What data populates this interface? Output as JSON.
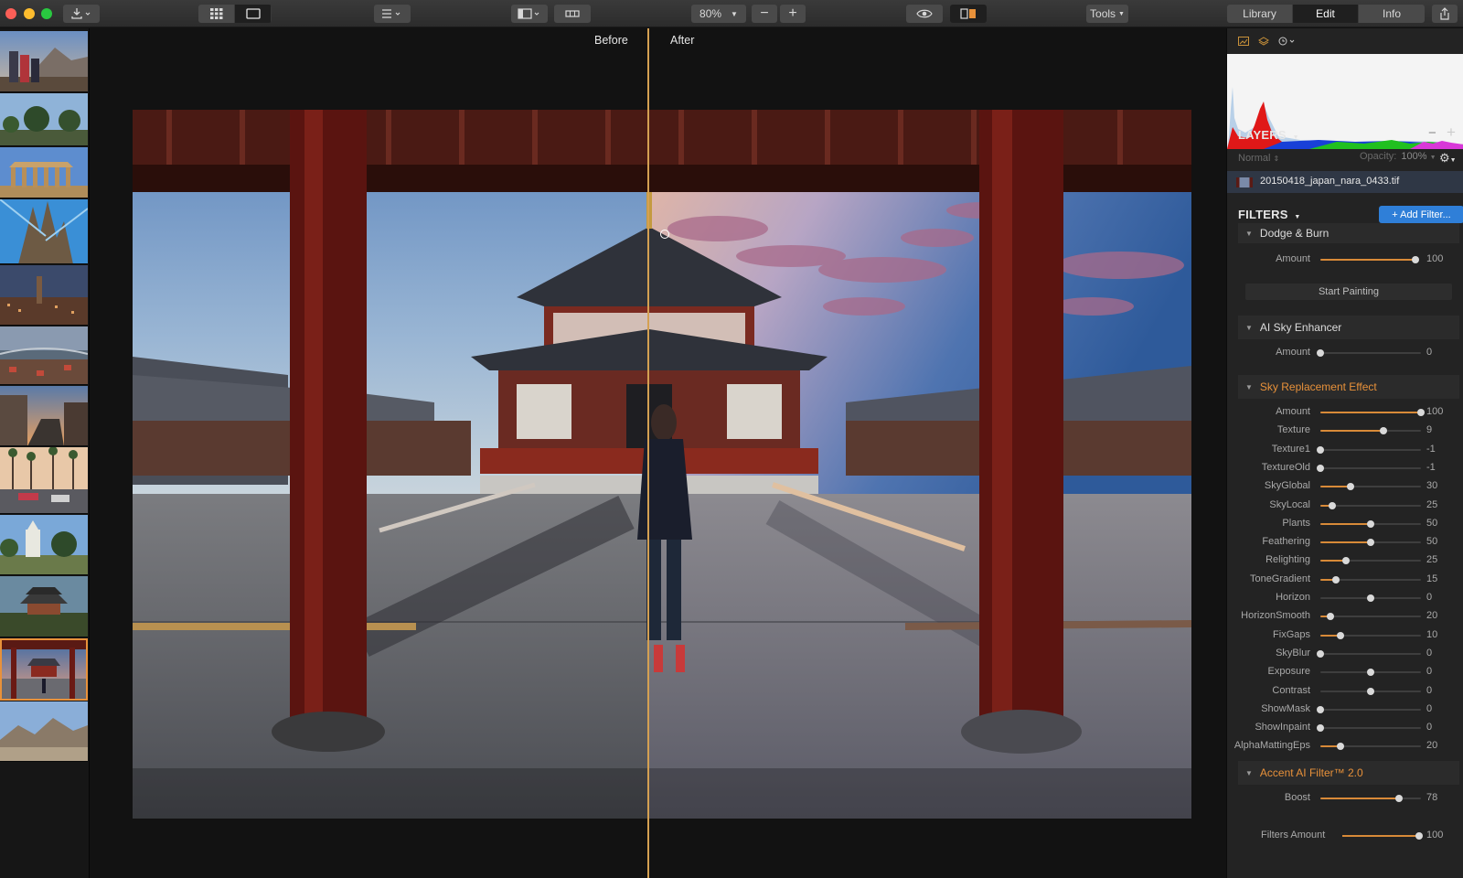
{
  "toolbar": {
    "zoom": "80%",
    "tools_label": "Tools",
    "mode_tabs": [
      "Library",
      "Edit",
      "Info"
    ],
    "active_tab": "Edit"
  },
  "canvas": {
    "before_label": "Before",
    "after_label": "After"
  },
  "filmstrip": {
    "thumbs": [
      {
        "theme": "people-mountain"
      },
      {
        "theme": "trees"
      },
      {
        "theme": "ruins"
      },
      {
        "theme": "cathedral"
      },
      {
        "theme": "city-dusk"
      },
      {
        "theme": "river-city"
      },
      {
        "theme": "street-sunset"
      },
      {
        "theme": "palm-street"
      },
      {
        "theme": "church-trees"
      },
      {
        "theme": "pagoda-garden"
      },
      {
        "theme": "temple-selected",
        "selected": true
      },
      {
        "theme": "desert"
      }
    ]
  },
  "panel": {
    "layers_title": "LAYERS",
    "blend_mode": "Normal",
    "opacity_label": "Opacity:",
    "opacity_value": "100%",
    "layer_name": "20150418_japan_nara_0433.tif",
    "filters_title": "FILTERS",
    "add_filter_label": "+ Add Filter...",
    "dodge_burn": {
      "title": "Dodge & Burn",
      "amount_label": "Amount",
      "amount_value": "100",
      "start_painting": "Start Painting"
    },
    "ai_sky": {
      "title": "AI Sky Enhancer",
      "amount_label": "Amount",
      "amount_value": "0"
    },
    "sky_replacement": {
      "title": "Sky Replacement Effect",
      "sliders": [
        {
          "label": "Amount",
          "value": "100",
          "pos": 1.0
        },
        {
          "label": "Texture",
          "value": "9",
          "pos": 0.63
        },
        {
          "label": "Texture1",
          "value": "-1",
          "pos": 0.0
        },
        {
          "label": "TextureOld",
          "value": "-1",
          "pos": 0.0
        },
        {
          "label": "SkyGlobal",
          "value": "30",
          "pos": 0.3
        },
        {
          "label": "SkyLocal",
          "value": "25",
          "pos": 0.12
        },
        {
          "label": "Plants",
          "value": "50",
          "pos": 0.5
        },
        {
          "label": "Feathering",
          "value": "50",
          "pos": 0.5
        },
        {
          "label": "Relighting",
          "value": "25",
          "pos": 0.25
        },
        {
          "label": "ToneGradient",
          "value": "15",
          "pos": 0.15
        },
        {
          "label": "Horizon",
          "value": "0",
          "pos": 0.5,
          "center": true
        },
        {
          "label": "HorizonSmooth",
          "value": "20",
          "pos": 0.1
        },
        {
          "label": "FixGaps",
          "value": "10",
          "pos": 0.2
        },
        {
          "label": "SkyBlur",
          "value": "0",
          "pos": 0.0
        },
        {
          "label": "Exposure",
          "value": "0",
          "pos": 0.5,
          "center": true
        },
        {
          "label": "Contrast",
          "value": "0",
          "pos": 0.5,
          "center": true
        },
        {
          "label": "ShowMask",
          "value": "0",
          "pos": 0.0
        },
        {
          "label": "ShowInpaint",
          "value": "0",
          "pos": 0.0
        },
        {
          "label": "AlphaMattingEps",
          "value": "20",
          "pos": 0.2
        }
      ]
    },
    "accent_ai": {
      "title": "Accent AI Filter™ 2.0",
      "boost_label": "Boost",
      "boost_value": "78",
      "boost_pos": 0.78
    },
    "filters_amount": {
      "label": "Filters Amount",
      "value": "100"
    }
  },
  "colors": {
    "accent": "#e8913a",
    "split_line": "#d4a052",
    "add_filter_bg": "#2f7fd8"
  }
}
